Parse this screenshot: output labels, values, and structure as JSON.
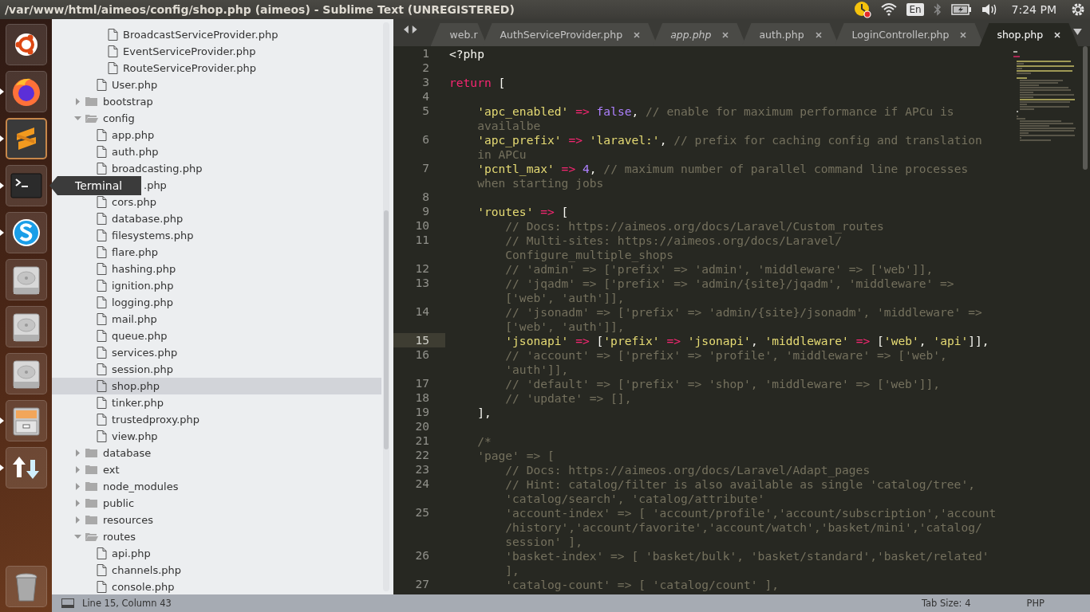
{
  "window": {
    "title": "/var/www/html/aimeos/config/shop.php (aimeos) - Sublime Text (UNREGISTERED)"
  },
  "top_bar": {
    "keyboard_layout": "En",
    "time": "7:24 PM"
  },
  "launcher": [
    {
      "running": false,
      "focused": false
    },
    {
      "running": true,
      "focused": false
    },
    {
      "running": true,
      "focused": true
    },
    {
      "running": true,
      "focused": false
    },
    {
      "running": true,
      "focused": false
    },
    {
      "running": false,
      "focused": false
    },
    {
      "running": false,
      "focused": false
    },
    {
      "running": false,
      "focused": false
    },
    {
      "running": true,
      "focused": false
    },
    {
      "running": true,
      "focused": false
    },
    {
      "running": false,
      "focused": false
    }
  ],
  "tooltip": {
    "text": "Terminal"
  },
  "sidebar": {
    "tree": [
      {
        "kind": "offscreen",
        "children": [
          {
            "kind": "offscreen",
            "children": [
              {
                "kind": "file",
                "name": "BroadcastServiceProvider.php",
                "selected": false
              },
              {
                "kind": "file",
                "name": "EventServiceProvider.php",
                "selected": false
              },
              {
                "kind": "file",
                "name": "RouteServiceProvider.php",
                "selected": false
              }
            ]
          },
          {
            "kind": "file",
            "name": "User.php",
            "selected": false
          }
        ]
      },
      {
        "kind": "folder",
        "name": "bootstrap",
        "expanded": false,
        "selected": false
      },
      {
        "kind": "folder",
        "name": "config",
        "expanded": true,
        "selected": false,
        "children": [
          {
            "kind": "file",
            "name": "app.php",
            "selected": false
          },
          {
            "kind": "file",
            "name": "auth.php",
            "selected": false
          },
          {
            "kind": "file",
            "name": "broadcasting.php",
            "selected": false
          },
          {
            "kind": "file",
            "name": ".php",
            "selected": false,
            "covered": true
          },
          {
            "kind": "file",
            "name": "cors.php",
            "selected": false
          },
          {
            "kind": "file",
            "name": "database.php",
            "selected": false
          },
          {
            "kind": "file",
            "name": "filesystems.php",
            "selected": false
          },
          {
            "kind": "file",
            "name": "flare.php",
            "selected": false
          },
          {
            "kind": "file",
            "name": "hashing.php",
            "selected": false
          },
          {
            "kind": "file",
            "name": "ignition.php",
            "selected": false
          },
          {
            "kind": "file",
            "name": "logging.php",
            "selected": false
          },
          {
            "kind": "file",
            "name": "mail.php",
            "selected": false
          },
          {
            "kind": "file",
            "name": "queue.php",
            "selected": false
          },
          {
            "kind": "file",
            "name": "services.php",
            "selected": false
          },
          {
            "kind": "file",
            "name": "session.php",
            "selected": false
          },
          {
            "kind": "file",
            "name": "shop.php",
            "selected": true
          },
          {
            "kind": "file",
            "name": "tinker.php",
            "selected": false
          },
          {
            "kind": "file",
            "name": "trustedproxy.php",
            "selected": false
          },
          {
            "kind": "file",
            "name": "view.php",
            "selected": false
          }
        ]
      },
      {
        "kind": "folder",
        "name": "database",
        "expanded": false,
        "selected": false
      },
      {
        "kind": "folder",
        "name": "ext",
        "expanded": false,
        "selected": false
      },
      {
        "kind": "folder",
        "name": "node_modules",
        "expanded": false,
        "selected": false
      },
      {
        "kind": "folder",
        "name": "public",
        "expanded": false,
        "selected": false
      },
      {
        "kind": "folder",
        "name": "resources",
        "expanded": false,
        "selected": false
      },
      {
        "kind": "folder",
        "name": "routes",
        "expanded": true,
        "selected": false,
        "children": [
          {
            "kind": "file",
            "name": "api.php",
            "selected": false
          },
          {
            "kind": "file",
            "name": "channels.php",
            "selected": false
          },
          {
            "kind": "file",
            "name": "console.php",
            "selected": false
          }
        ]
      }
    ]
  },
  "tabs": [
    {
      "label": "web.r",
      "selected": false,
      "transient": false
    },
    {
      "label": "AuthServiceProvider.php",
      "selected": false,
      "transient": false
    },
    {
      "label": "app.php",
      "selected": false,
      "transient": true
    },
    {
      "label": "auth.php",
      "selected": false,
      "transient": false
    },
    {
      "label": "LoginController.php",
      "selected": false,
      "transient": false
    },
    {
      "label": "shop.php",
      "selected": true,
      "transient": false
    }
  ],
  "editor": {
    "lines": [
      {
        "number": "1",
        "current": false,
        "rows": [
          [
            {
              "text": "<?php",
              "kind": "plain"
            }
          ]
        ]
      },
      {
        "number": "2",
        "current": false,
        "rows": [
          []
        ]
      },
      {
        "number": "3",
        "current": false,
        "rows": [
          [
            {
              "text": "return",
              "kind": "keyword"
            },
            {
              "text": " [",
              "kind": "plain"
            }
          ]
        ]
      },
      {
        "number": "4",
        "current": false,
        "rows": [
          []
        ]
      },
      {
        "number": "5",
        "current": false,
        "rows": [
          [
            {
              "text": "    'apc_enabled'",
              "kind": "string"
            },
            {
              "text": " ",
              "kind": "plain"
            },
            {
              "text": "=>",
              "kind": "operator"
            },
            {
              "text": " ",
              "kind": "plain"
            },
            {
              "text": "false",
              "kind": "constant"
            },
            {
              "text": ", ",
              "kind": "plain"
            },
            {
              "text": "// enable for maximum performance if APCu is",
              "kind": "comment"
            }
          ],
          [
            {
              "text": "    availalbe",
              "kind": "comment"
            }
          ]
        ]
      },
      {
        "number": "6",
        "current": false,
        "rows": [
          [
            {
              "text": "    'apc_prefix'",
              "kind": "string"
            },
            {
              "text": " ",
              "kind": "plain"
            },
            {
              "text": "=>",
              "kind": "operator"
            },
            {
              "text": " ",
              "kind": "plain"
            },
            {
              "text": "'laravel:'",
              "kind": "string"
            },
            {
              "text": ", ",
              "kind": "plain"
            },
            {
              "text": "// prefix for caching config and translation",
              "kind": "comment"
            }
          ],
          [
            {
              "text": "    in APCu",
              "kind": "comment"
            }
          ]
        ]
      },
      {
        "number": "7",
        "current": false,
        "rows": [
          [
            {
              "text": "    'pcntl_max'",
              "kind": "string"
            },
            {
              "text": " ",
              "kind": "plain"
            },
            {
              "text": "=>",
              "kind": "operator"
            },
            {
              "text": " ",
              "kind": "plain"
            },
            {
              "text": "4",
              "kind": "constant"
            },
            {
              "text": ", ",
              "kind": "plain"
            },
            {
              "text": "// maximum number of parallel command line processes",
              "kind": "comment"
            }
          ],
          [
            {
              "text": "    when starting jobs",
              "kind": "comment"
            }
          ]
        ]
      },
      {
        "number": "8",
        "current": false,
        "rows": [
          []
        ]
      },
      {
        "number": "9",
        "current": false,
        "rows": [
          [
            {
              "text": "    'routes'",
              "kind": "string"
            },
            {
              "text": " ",
              "kind": "plain"
            },
            {
              "text": "=>",
              "kind": "operator"
            },
            {
              "text": " [",
              "kind": "plain"
            }
          ]
        ]
      },
      {
        "number": "10",
        "current": false,
        "rows": [
          [
            {
              "text": "        // Docs: https://aimeos.org/docs/Laravel/Custom_routes",
              "kind": "comment"
            }
          ]
        ]
      },
      {
        "number": "11",
        "current": false,
        "rows": [
          [
            {
              "text": "        // Multi-sites: https://aimeos.org/docs/Laravel/",
              "kind": "comment"
            }
          ],
          [
            {
              "text": "        Configure_multiple_shops",
              "kind": "comment"
            }
          ]
        ]
      },
      {
        "number": "12",
        "current": false,
        "rows": [
          [
            {
              "text": "        // 'admin' => ['prefix' => 'admin', 'middleware' => ['web']],",
              "kind": "comment"
            }
          ]
        ]
      },
      {
        "number": "13",
        "current": false,
        "rows": [
          [
            {
              "text": "        // 'jqadm' => ['prefix' => 'admin/{site}/jqadm', 'middleware' =>",
              "kind": "comment"
            }
          ],
          [
            {
              "text": "        ['web', 'auth']],",
              "kind": "comment"
            }
          ]
        ]
      },
      {
        "number": "14",
        "current": false,
        "rows": [
          [
            {
              "text": "        // 'jsonadm' => ['prefix' => 'admin/{site}/jsonadm', 'middleware' =>",
              "kind": "comment"
            }
          ],
          [
            {
              "text": "        ['web', 'auth']],",
              "kind": "comment"
            }
          ]
        ]
      },
      {
        "number": "15",
        "current": true,
        "rows": [
          [
            {
              "text": "        'jsonapi'",
              "kind": "string"
            },
            {
              "text": " ",
              "kind": "plain"
            },
            {
              "text": "=>",
              "kind": "operator"
            },
            {
              "text": " [",
              "kind": "plain"
            },
            {
              "text": "'prefix'",
              "kind": "string"
            },
            {
              "text": " ",
              "kind": "plain"
            },
            {
              "text": "=>",
              "kind": "operator"
            },
            {
              "text": " ",
              "kind": "plain"
            },
            {
              "text": "'jsonapi'",
              "kind": "string"
            },
            {
              "text": ", ",
              "kind": "plain"
            },
            {
              "text": "'middleware'",
              "kind": "string"
            },
            {
              "text": " ",
              "kind": "plain"
            },
            {
              "text": "=>",
              "kind": "operator"
            },
            {
              "text": " [",
              "kind": "plain"
            },
            {
              "text": "'web'",
              "kind": "string"
            },
            {
              "text": ", ",
              "kind": "plain"
            },
            {
              "text": "'api'",
              "kind": "string"
            },
            {
              "text": "]],",
              "kind": "plain"
            }
          ]
        ]
      },
      {
        "number": "16",
        "current": false,
        "rows": [
          [
            {
              "text": "        // 'account' => ['prefix' => 'profile', 'middleware' => ['web',",
              "kind": "comment"
            }
          ],
          [
            {
              "text": "        'auth']],",
              "kind": "comment"
            }
          ]
        ]
      },
      {
        "number": "17",
        "current": false,
        "rows": [
          [
            {
              "text": "        // 'default' => ['prefix' => 'shop', 'middleware' => ['web']],",
              "kind": "comment"
            }
          ]
        ]
      },
      {
        "number": "18",
        "current": false,
        "rows": [
          [
            {
              "text": "        // 'update' => [],",
              "kind": "comment"
            }
          ]
        ]
      },
      {
        "number": "19",
        "current": false,
        "rows": [
          [
            {
              "text": "    ],",
              "kind": "plain"
            }
          ]
        ]
      },
      {
        "number": "20",
        "current": false,
        "rows": [
          []
        ]
      },
      {
        "number": "21",
        "current": false,
        "rows": [
          [
            {
              "text": "    /*",
              "kind": "comment"
            }
          ]
        ]
      },
      {
        "number": "22",
        "current": false,
        "rows": [
          [
            {
              "text": "    'page' => [",
              "kind": "comment"
            }
          ]
        ]
      },
      {
        "number": "23",
        "current": false,
        "rows": [
          [
            {
              "text": "        // Docs: https://aimeos.org/docs/Laravel/Adapt_pages",
              "kind": "comment"
            }
          ]
        ]
      },
      {
        "number": "24",
        "current": false,
        "rows": [
          [
            {
              "text": "        // Hint: catalog/filter is also available as single 'catalog/tree',",
              "kind": "comment"
            }
          ],
          [
            {
              "text": "        'catalog/search', 'catalog/attribute'",
              "kind": "comment"
            }
          ]
        ]
      },
      {
        "number": "25",
        "current": false,
        "rows": [
          [
            {
              "text": "        'account-index' => [ 'account/profile','account/subscription','account",
              "kind": "comment"
            }
          ],
          [
            {
              "text": "        /history','account/favorite','account/watch','basket/mini','catalog/",
              "kind": "comment"
            }
          ],
          [
            {
              "text": "        session' ],",
              "kind": "comment"
            }
          ]
        ]
      },
      {
        "number": "26",
        "current": false,
        "rows": [
          [
            {
              "text": "        'basket-index' => [ 'basket/bulk', 'basket/standard','basket/related'",
              "kind": "comment"
            }
          ],
          [
            {
              "text": "        ],",
              "kind": "comment"
            }
          ]
        ]
      },
      {
        "number": "27",
        "current": false,
        "rows": [
          [
            {
              "text": "        'catalog-count' => [ 'catalog/count' ],",
              "kind": "comment"
            }
          ]
        ]
      }
    ]
  },
  "status_bar": {
    "position": "Line 15, Column 43",
    "tab_size": "Tab Size: 4",
    "syntax": "PHP"
  }
}
